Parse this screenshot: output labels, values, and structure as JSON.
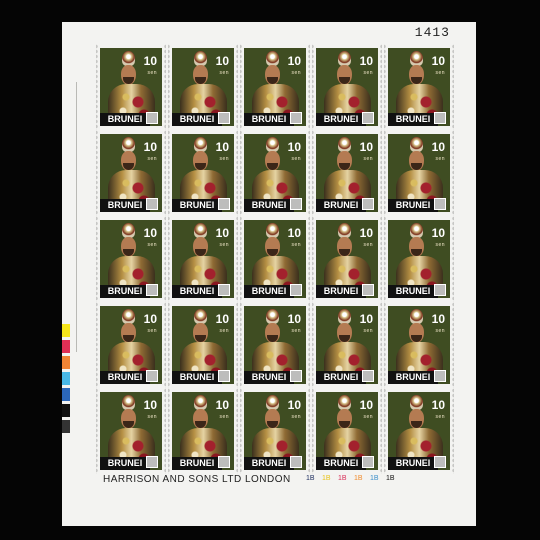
{
  "sheet": {
    "sheet_number": "1413",
    "stamp_country": "BRUNEI",
    "stamp_value": "10",
    "stamp_currency": "sen",
    "imprint": "HARRISON AND SONS LTD LONDON",
    "cylinder_numbers": [
      "1B",
      "1B",
      "1B",
      "1B",
      "1B",
      "1B"
    ],
    "stamp_count": 25,
    "colors": [
      "#f5e51b",
      "#e02f55",
      "#f08435",
      "#48b8e7",
      "#2b67ba",
      "#111111",
      "#333333"
    ]
  }
}
